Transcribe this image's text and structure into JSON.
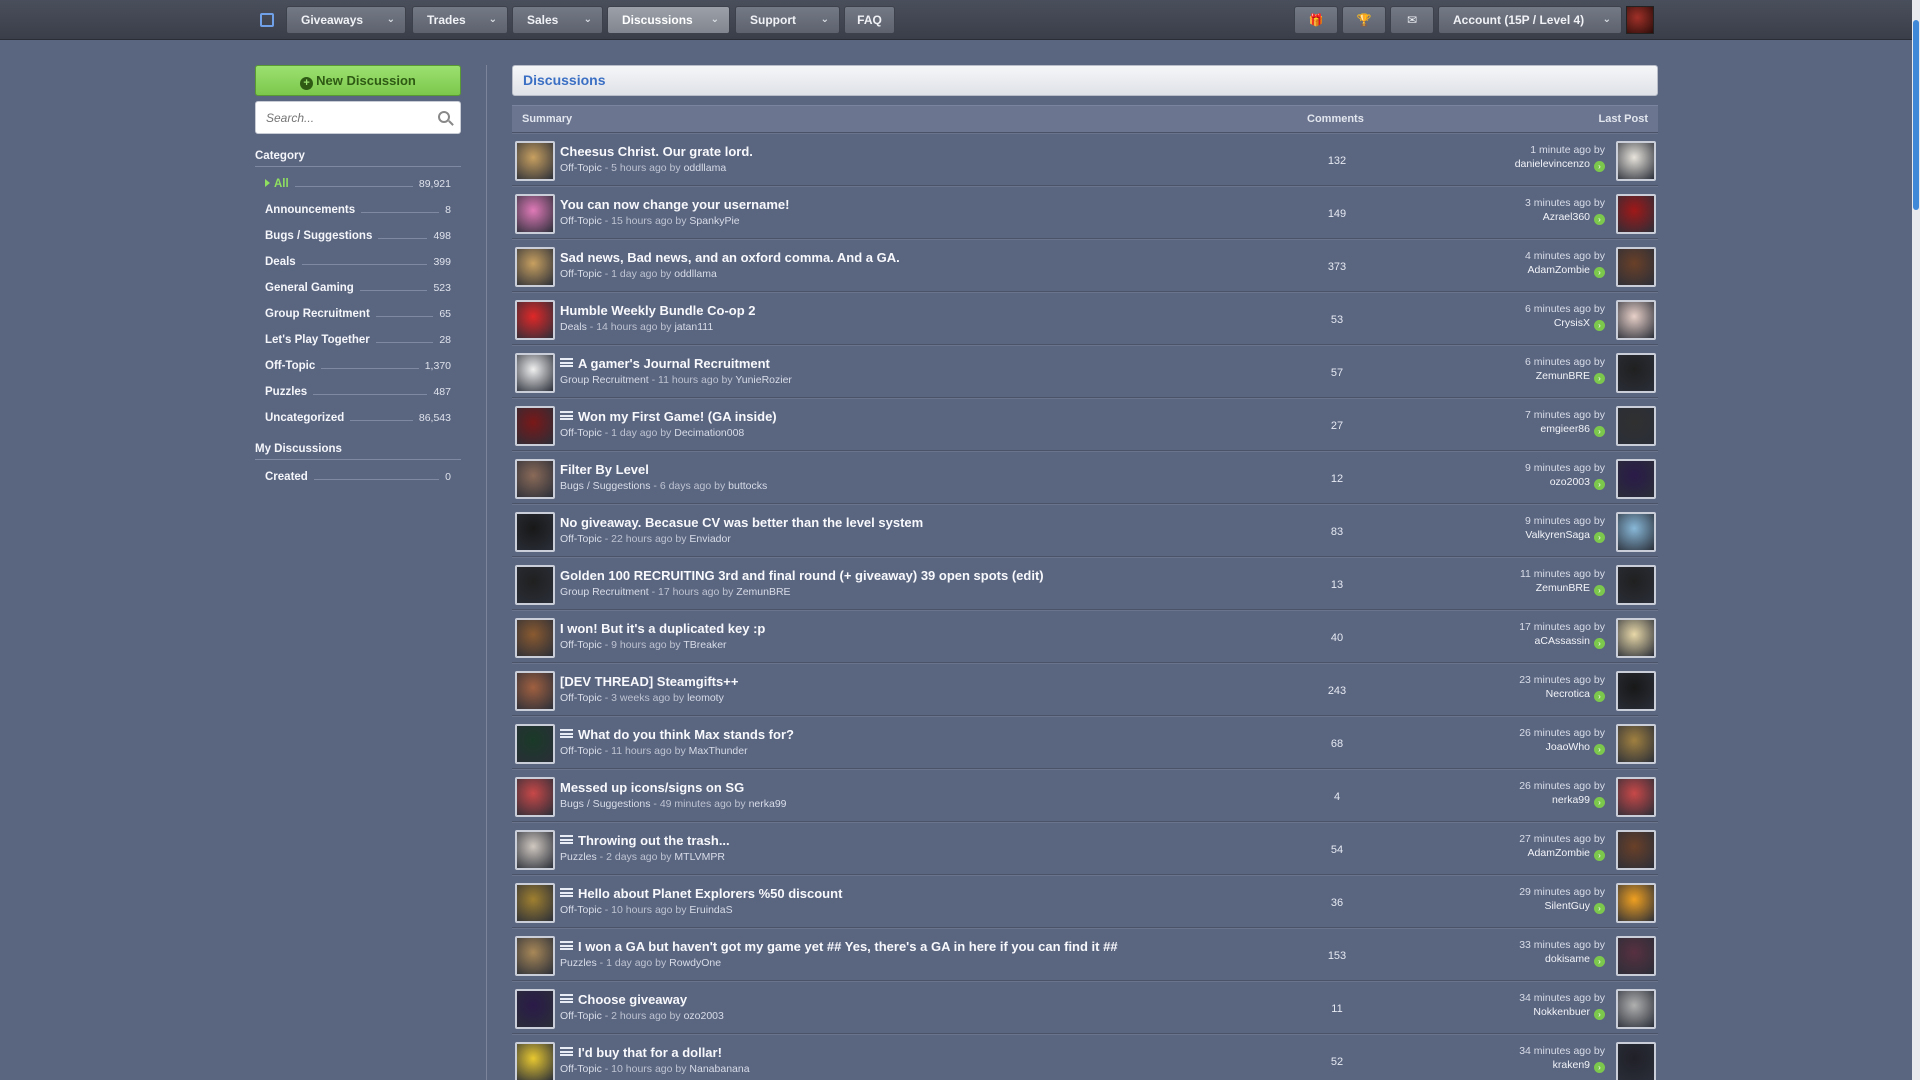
{
  "nav": {
    "items": [
      {
        "label": "Giveaways",
        "dropdown": true
      },
      {
        "label": "Trades",
        "dropdown": true
      },
      {
        "label": "Sales",
        "dropdown": true
      },
      {
        "label": "Discussions",
        "dropdown": true,
        "active": true
      },
      {
        "label": "Support",
        "dropdown": true
      },
      {
        "label": "FAQ",
        "dropdown": false
      }
    ],
    "icons": [
      "gift-icon",
      "trophy-icon",
      "mail-icon"
    ],
    "account_label": "Account (15P / Level 4)"
  },
  "sidebar": {
    "new_discussion_label": "New Discussion",
    "search_placeholder": "Search...",
    "category_heading": "Category",
    "categories": [
      {
        "label": "All",
        "count": "89,921",
        "active": true
      },
      {
        "label": "Announcements",
        "count": "8"
      },
      {
        "label": "Bugs / Suggestions",
        "count": "498"
      },
      {
        "label": "Deals",
        "count": "399"
      },
      {
        "label": "General Gaming",
        "count": "523"
      },
      {
        "label": "Group Recruitment",
        "count": "65"
      },
      {
        "label": "Let's Play Together",
        "count": "28"
      },
      {
        "label": "Off-Topic",
        "count": "1,370"
      },
      {
        "label": "Puzzles",
        "count": "487"
      },
      {
        "label": "Uncategorized",
        "count": "86,543"
      }
    ],
    "my_heading": "My Discussions",
    "my_items": [
      {
        "label": "Created",
        "count": "0"
      }
    ]
  },
  "main": {
    "title": "Discussions",
    "col_summary": "Summary",
    "col_comments": "Comments",
    "col_last": "Last Post",
    "rows": [
      {
        "title": "Cheesus Christ. Our grate lord.",
        "poll": false,
        "category": "Off-Topic",
        "age": "5 hours ago",
        "author": "oddllama",
        "comments": "132",
        "last_time": "1 minute ago by",
        "last_user": "danielevincenzo",
        "av1": "#c8a060",
        "av2": "#e8e4dc"
      },
      {
        "title": "You can now change your username!",
        "poll": false,
        "category": "Off-Topic",
        "age": "15 hours ago",
        "author": "SpankyPie",
        "comments": "149",
        "last_time": "3 minutes ago by",
        "last_user": "Azrael360",
        "av1": "#e07ab8",
        "av2": "#a01818"
      },
      {
        "title": "Sad news, Bad news, and an oxford comma. And a GA.",
        "poll": false,
        "category": "Off-Topic",
        "age": "1 day ago",
        "author": "oddllama",
        "comments": "373",
        "last_time": "4 minutes ago by",
        "last_user": "AdamZombie",
        "av1": "#c8a060",
        "av2": "#6a4028"
      },
      {
        "title": "Humble Weekly Bundle Co-op 2",
        "poll": false,
        "category": "Deals",
        "age": "14 hours ago",
        "author": "jatan111",
        "comments": "53",
        "last_time": "6 minutes ago by",
        "last_user": "CrysisX",
        "av1": "#e02828",
        "av2": "#e8d0c8"
      },
      {
        "title": "A gamer's Journal Recruitment",
        "poll": true,
        "category": "Group Recruitment",
        "age": "11 hours ago",
        "author": "YunieRozier",
        "comments": "57",
        "last_time": "6 minutes ago by",
        "last_user": "ZemunBRE",
        "av1": "#f0f0f0",
        "av2": "#202020"
      },
      {
        "title": "Won my First Game! (GA inside)",
        "poll": true,
        "category": "Off-Topic",
        "age": "1 day ago",
        "author": "Decimation008",
        "comments": "27",
        "last_time": "7 minutes ago by",
        "last_user": "emgieer86",
        "av1": "#7a1818",
        "av2": "#303030"
      },
      {
        "title": "Filter By Level",
        "poll": false,
        "category": "Bugs / Suggestions",
        "age": "6 days ago",
        "author": "buttocks",
        "comments": "12",
        "last_time": "9 minutes ago by",
        "last_user": "ozo2003",
        "av1": "#8a6a58",
        "av2": "#2a1a48"
      },
      {
        "title": "No giveaway. Becasue CV was better than the level system",
        "poll": false,
        "category": "Off-Topic",
        "age": "22 hours ago",
        "author": "Enviador",
        "comments": "83",
        "last_time": "9 minutes ago by",
        "last_user": "ValkyrenSaga",
        "av1": "#181818",
        "av2": "#88b8d8"
      },
      {
        "title": "Golden 100 RECRUITING 3rd and final round (+ giveaway) 39 open spots (edit)",
        "poll": false,
        "category": "Group Recruitment",
        "age": "17 hours ago",
        "author": "ZemunBRE",
        "comments": "13",
        "last_time": "11 minutes ago by",
        "last_user": "ZemunBRE",
        "av1": "#202020",
        "av2": "#202020"
      },
      {
        "title": "I won! But it's a duplicated key :p",
        "poll": false,
        "category": "Off-Topic",
        "age": "9 hours ago",
        "author": "TBreaker",
        "comments": "40",
        "last_time": "17 minutes ago by",
        "last_user": "aCAssassin",
        "av1": "#8a5a30",
        "av2": "#e8d8a8"
      },
      {
        "title": "[DEV THREAD] Steamgifts++",
        "poll": false,
        "category": "Off-Topic",
        "age": "3 weeks ago",
        "author": "leomoty",
        "comments": "243",
        "last_time": "23 minutes ago by",
        "last_user": "Necrotica",
        "av1": "#a06040",
        "av2": "#181818"
      },
      {
        "title": "What do you think Max stands for?",
        "poll": true,
        "category": "Off-Topic",
        "age": "11 hours ago",
        "author": "MaxThunder",
        "comments": "68",
        "last_time": "26 minutes ago by",
        "last_user": "JoaoWho",
        "av1": "#1a3a28",
        "av2": "#a08040"
      },
      {
        "title": "Messed up icons/signs on SG",
        "poll": false,
        "category": "Bugs / Suggestions",
        "age": "49 minutes ago",
        "author": "nerka99",
        "comments": "4",
        "last_time": "26 minutes ago by",
        "last_user": "nerka99",
        "av1": "#c84848",
        "av2": "#c84848"
      },
      {
        "title": "Throwing out the trash...",
        "poll": true,
        "category": "Puzzles",
        "age": "2 days ago",
        "author": "MTLVMPR",
        "comments": "54",
        "last_time": "27 minutes ago by",
        "last_user": "AdamZombie",
        "av1": "#d0c8c0",
        "av2": "#6a4028"
      },
      {
        "title": "Hello about Planet Explorers %50 discount",
        "poll": true,
        "category": "Off-Topic",
        "age": "10 hours ago",
        "author": "EruindaS",
        "comments": "36",
        "last_time": "29 minutes ago by",
        "last_user": "SilentGuy",
        "av1": "#a08030",
        "av2": "#f0a020"
      },
      {
        "title": "I won a GA but haven't got my game yet ## Yes, there's a GA in here if you can find it ##",
        "poll": true,
        "category": "Puzzles",
        "age": "1 day ago",
        "author": "RowdyOne",
        "comments": "153",
        "last_time": "33 minutes ago by",
        "last_user": "dokisame",
        "av1": "#a88858",
        "av2": "#583040"
      },
      {
        "title": "Choose giveaway",
        "poll": true,
        "category": "Off-Topic",
        "age": "2 hours ago",
        "author": "ozo2003",
        "comments": "11",
        "last_time": "34 minutes ago by",
        "last_user": "Nokkenbuer",
        "av1": "#2a1a48",
        "av2": "#b0b0b0"
      },
      {
        "title": "I'd buy that for a dollar!",
        "poll": true,
        "category": "Off-Topic",
        "age": "10 hours ago",
        "author": "Nanabanana",
        "comments": "52",
        "last_time": "34 minutes ago by",
        "last_user": "kraken9",
        "av1": "#e8c830",
        "av2": "#202028"
      }
    ]
  }
}
